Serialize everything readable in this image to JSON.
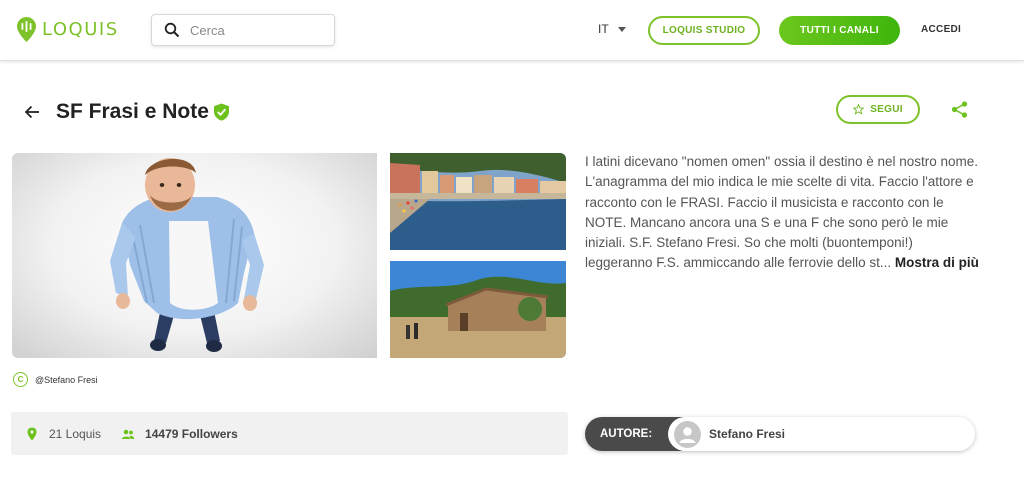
{
  "header": {
    "logo_text": "LOQUIS",
    "search_placeholder": "Cerca",
    "language": "IT",
    "studio_label": "LOQUIS STUDIO",
    "channels_label": "TUTTI I CANALI",
    "login_label": "ACCEDI"
  },
  "channel": {
    "title": "SF Frasi e Note",
    "follow_label": "SEGUI",
    "credit": "@Stefano Fresi",
    "description": "I latini dicevano \"nomen omen\" ossia il destino è nel nostro nome. L'anagramma del mio indica le mie scelte di vita. Faccio l'attore e racconto con le FRASI. Faccio il musicista e racconto con le NOTE. Mancano ancora una S e una F che sono però le mie iniziali. S.F. Stefano Fresi. So che molti (buontemponi!) leggeranno F.S. ammiccando alle ferrovie dello st...",
    "more_label": "Mostra di più",
    "stats": {
      "loquis": "21 Loquis",
      "followers": "14479 Followers"
    },
    "author": {
      "tag": "AUTORE:",
      "name": "Stefano Fresi"
    }
  },
  "colors": {
    "brand_green": "#7dc22a",
    "author_tag_bg": "#4a4a4a"
  },
  "icons": [
    "logo-pin-icon",
    "search-icon",
    "chevron-down-icon",
    "back-arrow-icon",
    "verified-shield-icon",
    "star-icon",
    "share-icon",
    "copyright-icon",
    "pin-icon",
    "users-icon",
    "user-icon"
  ]
}
